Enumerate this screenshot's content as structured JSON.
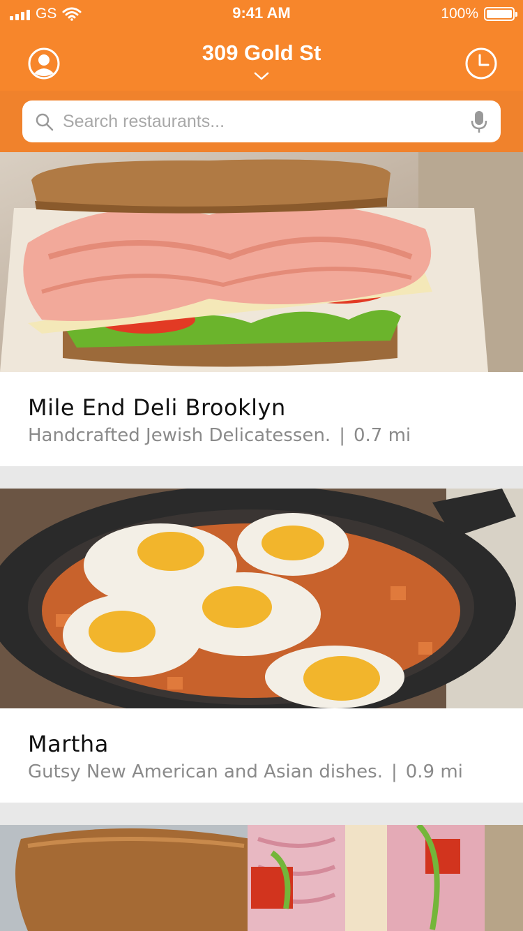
{
  "status_bar": {
    "carrier": "GS",
    "time": "9:41 AM",
    "battery_percent": "100%"
  },
  "header": {
    "location": "309 Gold St"
  },
  "search": {
    "placeholder": "Search restaurants..."
  },
  "restaurants": [
    {
      "name": "Mile End Deli Brooklyn",
      "description": "Handcrafted Jewish Delicatessen.",
      "separator": "|",
      "distance": "0.7 mi"
    },
    {
      "name": "Martha",
      "description": "Gutsy New American and Asian dishes.",
      "separator": "|",
      "distance": "0.9 mi"
    },
    {
      "name": "",
      "description": "",
      "separator": "",
      "distance": ""
    }
  ],
  "colors": {
    "brand_orange": "#f7862b",
    "search_bar_bg": "#f0822c"
  }
}
